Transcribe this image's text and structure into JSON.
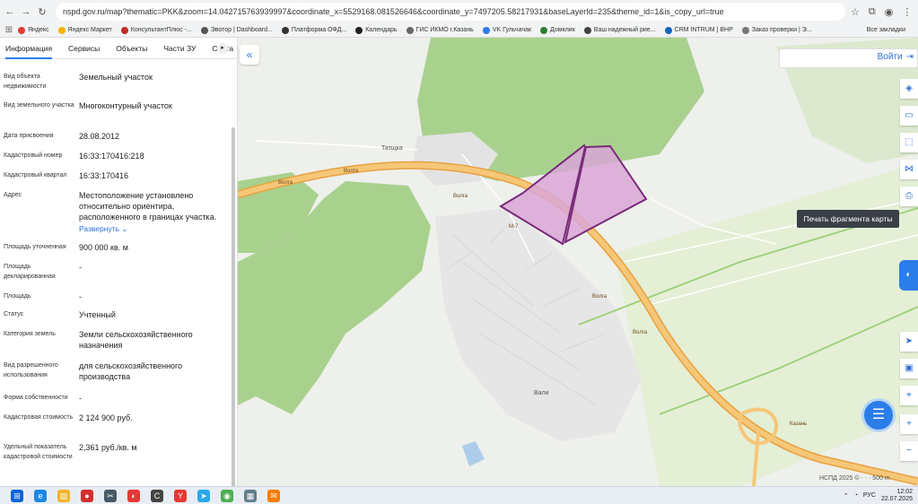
{
  "browser": {
    "url": "nspd.gov.ru/map?thematic=PKK&zoom=14.042715763939997&coordinate_x=5529168.081526646&coordinate_y=7497205.58217931&baseLayerId=235&theme_id=1&is_copy_url=true",
    "bookmarks": [
      "Яндекс",
      "Яндекс Маркет",
      "КонсультантПлюс -...",
      "Эвотор | Dashboard...",
      "Платформа ОФД...",
      "Календарь",
      "ГИС ИКМО г.Казань",
      "VK Гульчачак",
      "Домклик",
      "Ваш надежный рие...",
      "CRM INTRUM | BHP",
      "Заказ проверки | Э..."
    ],
    "all_bookmarks": "Все закладки"
  },
  "panel": {
    "tabs": [
      "Информация",
      "Сервисы",
      "Объекты",
      "Части ЗУ",
      "Соста"
    ],
    "rows": [
      {
        "label": "Вид объекта недвижимости",
        "value": "Земельный участок"
      },
      {
        "label": "Вид земельного участка",
        "value": "Многоконтурный участок"
      },
      {
        "label": "Дата присвоения",
        "value": "28.08.2012"
      },
      {
        "label": "Кадастровый номер",
        "value": "16:33:170416:218"
      },
      {
        "label": "Кадастровый квартал",
        "value": "16:33:170416"
      },
      {
        "label": "Адрес",
        "value": "Местоположение установлено относительно ориентира, расположенного в границах участка.",
        "link": "Развернуть"
      },
      {
        "label": "Площадь уточненная",
        "value": "900 000 кв. м"
      },
      {
        "label": "Площадь декларированная",
        "value": "-"
      },
      {
        "label": "Площадь",
        "value": "-"
      },
      {
        "label": "Статус",
        "value": "Учтенный"
      },
      {
        "label": "Категория земель",
        "value": "Земли сельскохозяйственного назначения"
      },
      {
        "label": "Вид разрешенного использования",
        "value": "для сельскохозяйственного производства"
      },
      {
        "label": "Форма собственности",
        "value": "-"
      },
      {
        "label": "Кадастровая стоимость",
        "value": "2 124 900 руб."
      },
      {
        "label": "Удельный показатель кадастровой стоимости",
        "value": "2,361 руб./кв. м"
      }
    ]
  },
  "map": {
    "login": "Войти",
    "tooltip": "Печать фрагмента карты",
    "attribution": "НСПД 2025 ©",
    "scale": "500 m",
    "labels": {
      "village1": "Татщка",
      "village2": "Вали",
      "road": "Волга",
      "road_kazan": "Казань",
      "route": "М-7"
    }
  },
  "taskbar": {
    "lang": "РУС",
    "time": "12:02",
    "date": "22.07.2025"
  },
  "colors": {
    "accent": "#2b7de9",
    "parcel_fill": "#d9a6d6",
    "parcel_stroke": "#7a2a7a",
    "forest": "#a9d18e",
    "road": "#f2b85c"
  }
}
